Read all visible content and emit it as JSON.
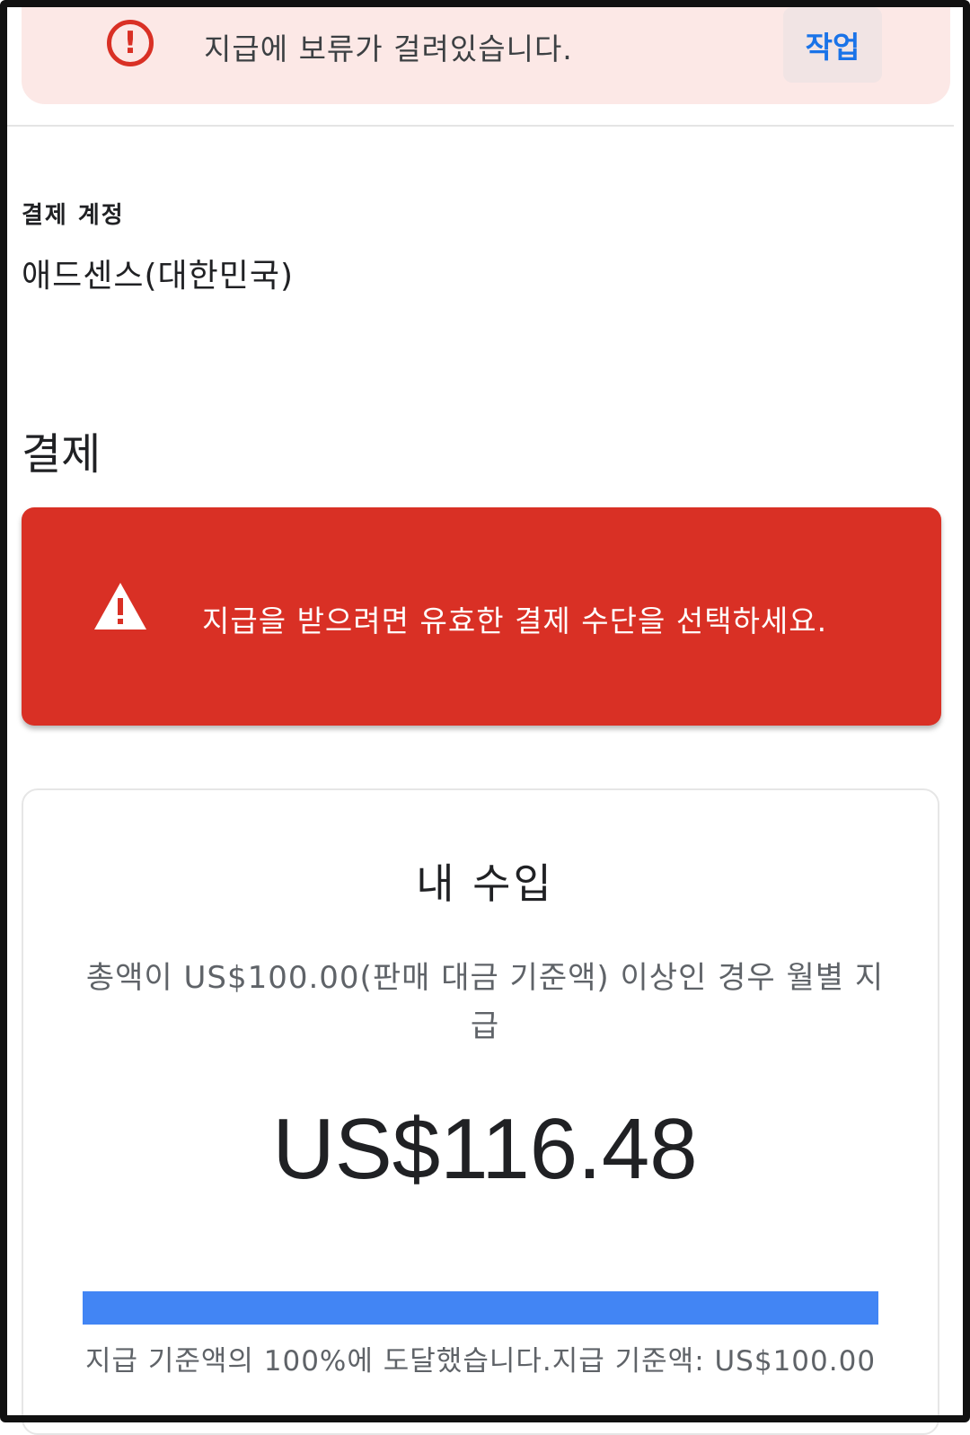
{
  "hold_banner": {
    "message": "지급에 보류가 걸려있습니다.",
    "action_label": "작업",
    "icon": "error-circle-icon",
    "color": "#d93025"
  },
  "billing_account": {
    "label": "결제 계정",
    "value": "애드센스(대한민국)"
  },
  "payment_section": {
    "title": "결제",
    "alert": {
      "icon": "warning-triangle-icon",
      "message": "지급을 받으려면 유효한 결제 수단을 선택하세요.",
      "color": "#d93025"
    }
  },
  "earnings": {
    "title": "내 수입",
    "description": "총액이 US$100.00(판매 대금 기준액) 이상인 경우 월별 지급",
    "amount": "US$116.48",
    "progress_fraction": 1.0,
    "progress_color": "#4285f4",
    "progress_caption": "지급 기준액의 100%에 도달했습니다.지급 기준액: US$100.00"
  }
}
